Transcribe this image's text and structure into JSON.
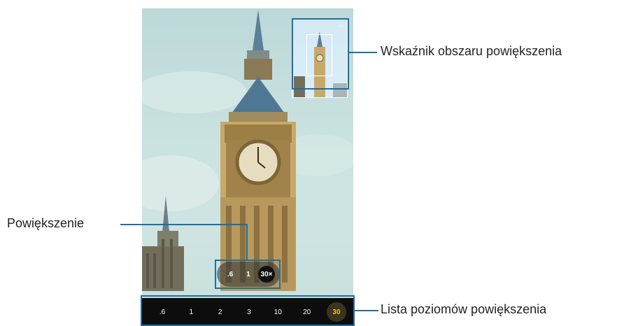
{
  "preview": {
    "zoom_options": [
      ".6",
      "1",
      "30×"
    ],
    "active_zoom": "30×",
    "minimap_icon": "stabilizer-icon"
  },
  "zoom_list": {
    "levels": [
      ".6",
      "1",
      "2",
      "3",
      "10",
      "20",
      "30"
    ],
    "active": "30"
  },
  "callouts": {
    "indicator": "Wskaźnik obszaru powiększenia",
    "zoom": "Powiększenie",
    "list": "Lista poziomów powiększenia"
  },
  "colors": {
    "callout": "#1f6f9e",
    "active_level": "#f2c318"
  }
}
